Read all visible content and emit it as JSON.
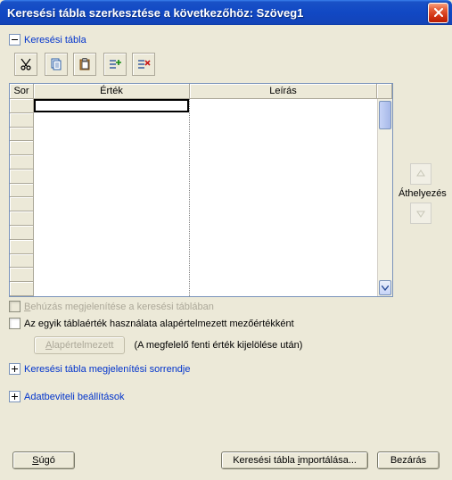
{
  "window": {
    "title": "Keresési tábla szerkesztése a következőhöz: Szöveg1"
  },
  "section_search_table": {
    "label": "Keresési tábla"
  },
  "toolbar": {
    "cut": "cut",
    "copy": "copy",
    "paste": "paste",
    "insert_row": "insert-row",
    "delete_row": "delete-row"
  },
  "table": {
    "col_row": "Sor",
    "col_value": "Érték",
    "col_desc": "Leírás"
  },
  "move": {
    "label": "Áthelyezés"
  },
  "chk_indent": {
    "label_pre": "Behúzás megjelenítése a keresési táblában",
    "u": "B"
  },
  "chk_default": {
    "label": "Az egyik táblaérték használata alapértelmezett mezőértékként"
  },
  "btn_default": {
    "label": "Alapértelmezett",
    "u": "A"
  },
  "note_default": "(A megfelelő fenti érték kijelölése után)",
  "section_order": {
    "label": "Keresési tábla megjelenítési sorrendje"
  },
  "section_input": {
    "label": "Adatbeviteli beállítások"
  },
  "footer": {
    "help": "Súgó",
    "help_u": "S",
    "import": "Keresési tábla importálása...",
    "import_u": "i",
    "close": "Bezárás"
  }
}
